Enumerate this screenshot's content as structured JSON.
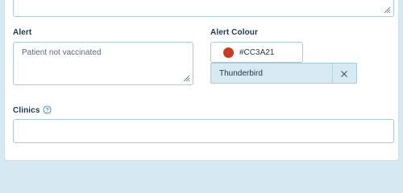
{
  "form": {
    "alert": {
      "label": "Alert",
      "value": "Patient not vaccinated"
    },
    "alert_colour": {
      "label": "Alert Colour",
      "hex": "#CC3A21",
      "swatch_color": "#cc3a21",
      "selected_name": "Thunderbird"
    },
    "clinics": {
      "label": "Clinics",
      "value": ""
    }
  },
  "icons": {
    "resize_grip": "resize-grip-icon",
    "help": "help-circle-icon",
    "clear": "close-icon"
  }
}
